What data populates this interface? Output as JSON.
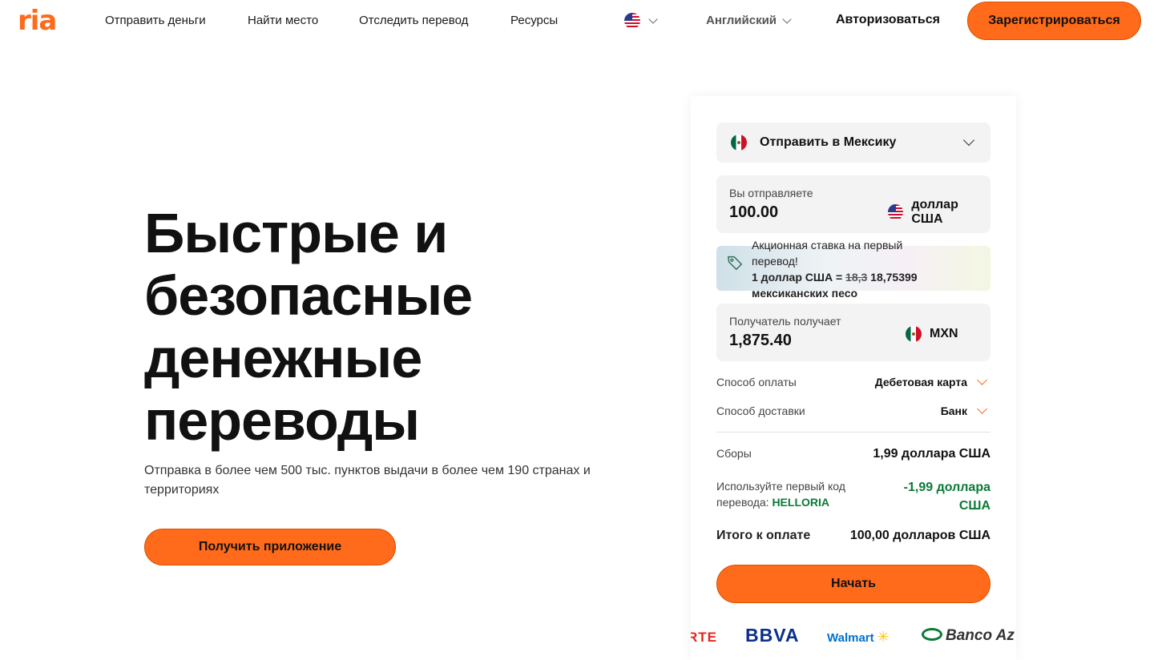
{
  "header": {
    "logo": "ria",
    "nav": [
      "Отправить деньги",
      "Найти место",
      "Отследить перевод",
      "Ресурсы"
    ],
    "language": "Английский",
    "login": "Авторизоваться",
    "register": "Зарегистрироваться"
  },
  "hero": {
    "title": "Быстрые и безопасные денежные переводы",
    "subtitle": "Отправка в более чем 500 тыс. пунктов выдачи в более чем 190 странах и территориях",
    "app_button": "Получить приложение"
  },
  "calculator": {
    "destination": "Отправить в Мексику",
    "send_label": "Вы отправляете",
    "send_amount": "100.00",
    "send_currency": "доллар США",
    "promo_title": "Акционная ставка на первый перевод!",
    "promo_rate_prefix": "1 доллар США =",
    "promo_old_rate": "18,3",
    "promo_new_rate": "18,75399",
    "promo_rate_suffix": "мексиканских песо",
    "receive_label": "Получатель получает",
    "receive_amount": "1,875.40",
    "receive_currency": "MXN",
    "payment_label": "Способ оплаты",
    "payment_value": "Дебетовая карта",
    "delivery_label": "Способ доставки",
    "delivery_value": "Банк",
    "fees_label": "Сборы",
    "fees_value": "1,99 доллара США",
    "code_label": "Используйте первый код перевода:",
    "code_value": "HELLORIA",
    "discount_value": "-1,99 доллара США",
    "total_label": "Итого к оплате",
    "total_value": "100,00 долларов США",
    "start_button": "Начать"
  },
  "partners": [
    "RTE",
    "BBVA",
    "Walmart",
    "Banco Az"
  ],
  "colors": {
    "accent": "#ff6b1a",
    "promo_green": "#0a7a35"
  }
}
